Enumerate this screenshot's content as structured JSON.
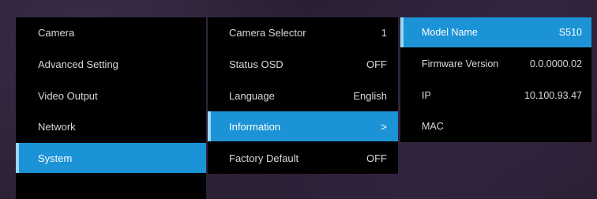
{
  "colors": {
    "background": "#2a1f33",
    "panel": "#000000",
    "selected": "#1b93d6",
    "selected_edge": "#9fd6f5",
    "text": "#d8d8d8"
  },
  "menu": {
    "items": [
      {
        "label": "Camera"
      },
      {
        "label": "Advanced Setting"
      },
      {
        "label": "Video Output"
      },
      {
        "label": "Network"
      },
      {
        "label": "System"
      }
    ],
    "selected": "System"
  },
  "system": {
    "items": [
      {
        "label": "Camera Selector",
        "value": "1"
      },
      {
        "label": "Status OSD",
        "value": "OFF"
      },
      {
        "label": "Language",
        "value": "English"
      },
      {
        "label": "Information",
        "value": ">"
      },
      {
        "label": "Factory Default",
        "value": "OFF"
      }
    ],
    "selected": "Information"
  },
  "information": {
    "items": [
      {
        "label": "Model Name",
        "value": "S510"
      },
      {
        "label": "Firmware Version",
        "value": "0.0.0000.02"
      },
      {
        "label": "IP",
        "value": "10.100.93.47"
      },
      {
        "label": "MAC",
        "value": ""
      }
    ],
    "selected": "Model Name"
  }
}
